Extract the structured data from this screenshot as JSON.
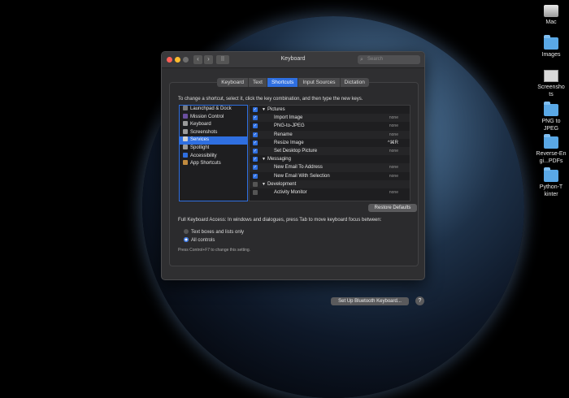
{
  "window": {
    "title": "Keyboard",
    "search_placeholder": "Search",
    "back_glyph": "‹",
    "forward_glyph": "›",
    "grid_glyph": "⠿"
  },
  "tabs": [
    {
      "label": "Keyboard"
    },
    {
      "label": "Text"
    },
    {
      "label": "Shortcuts",
      "active": true
    },
    {
      "label": "Input Sources"
    },
    {
      "label": "Dictation"
    }
  ],
  "instruction": "To change a shortcut, select it, click the key combination, and then type the new keys.",
  "categories": [
    {
      "label": "Launchpad & Dock",
      "icon": "launchpad-icon",
      "color": "#7a7a7a"
    },
    {
      "label": "Mission Control",
      "icon": "mission-control-icon",
      "color": "#6b4f9f"
    },
    {
      "label": "Keyboard",
      "icon": "keyboard-icon",
      "color": "#9a9a9a"
    },
    {
      "label": "Screenshots",
      "icon": "screenshot-icon",
      "color": "#9a9a9a"
    },
    {
      "label": "Services",
      "icon": "gear-icon",
      "color": "#cfcfcf",
      "selected": true
    },
    {
      "label": "Spotlight",
      "icon": "spotlight-icon",
      "color": "#9a9a9a"
    },
    {
      "label": "Accessibility",
      "icon": "accessibility-icon",
      "color": "#2f6fe0"
    },
    {
      "label": "App Shortcuts",
      "icon": "app-shortcuts-icon",
      "color": "#c08a3e"
    }
  ],
  "shortcuts": [
    {
      "label": "Pictures",
      "group": true,
      "checked": true
    },
    {
      "label": "Import Image",
      "key": "none",
      "checked": true
    },
    {
      "label": "PNG-to-JPEG",
      "key": "none",
      "checked": true
    },
    {
      "label": "Rename",
      "key": "none",
      "checked": true
    },
    {
      "label": "Resize Image",
      "key": "^⌘R",
      "checked": true
    },
    {
      "label": "Set Desktop Picture",
      "key": "none",
      "checked": true
    },
    {
      "label": "Messaging",
      "group": true,
      "checked": true
    },
    {
      "label": "New Email To Address",
      "key": "none",
      "checked": true
    },
    {
      "label": "New Email With Selection",
      "key": "none",
      "checked": true
    },
    {
      "label": "Development",
      "group": true,
      "checked": false
    },
    {
      "label": "Activity Monitor",
      "key": "none",
      "checked": false
    }
  ],
  "restore_defaults": "Restore Defaults",
  "full_keyboard_access": "Full Keyboard Access: In windows and dialogues, press Tab to move keyboard focus between:",
  "radio_options": [
    {
      "label": "Text boxes and lists only",
      "selected": false
    },
    {
      "label": "All controls",
      "selected": true
    }
  ],
  "note": "Press Control+F7 to change this setting.",
  "bluetooth_button": "Set Up Bluetooth Keyboard...",
  "help_label": "?",
  "desktop_icons": [
    {
      "label": "Mac",
      "kind": "drive"
    },
    {
      "label": "Images",
      "kind": "folder"
    },
    {
      "label": "Screenshots",
      "kind": "shot"
    },
    {
      "label": "PNG to JPEG",
      "kind": "folder"
    },
    {
      "label": "Reverse-Engi...PDFs",
      "kind": "folder"
    },
    {
      "label": "Python-Tkinter",
      "kind": "folder"
    }
  ],
  "colors": {
    "accent": "#2f6fe0",
    "close": "#fe5f57",
    "minimize": "#febc2e",
    "zoom": "#6e6e6e"
  }
}
